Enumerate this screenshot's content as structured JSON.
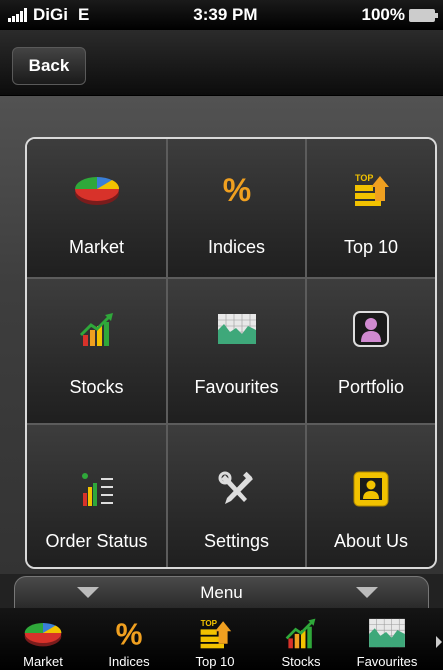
{
  "status_bar": {
    "carrier": "DiGi",
    "network": "E",
    "time": "3:39 PM",
    "battery": "100%"
  },
  "navbar": {
    "back_label": "Back"
  },
  "grid": {
    "items": [
      {
        "label": "Market",
        "icon": "pie-chart-icon"
      },
      {
        "label": "Indices",
        "icon": "percent-icon"
      },
      {
        "label": "Top 10",
        "icon": "top-icon"
      },
      {
        "label": "Stocks",
        "icon": "bar-trend-icon"
      },
      {
        "label": "Favourites",
        "icon": "area-chart-icon"
      },
      {
        "label": "Portfolio",
        "icon": "portfolio-icon"
      },
      {
        "label": "Order Status",
        "icon": "list-icon"
      },
      {
        "label": "Settings",
        "icon": "tools-icon"
      },
      {
        "label": "About Us",
        "icon": "person-icon"
      }
    ],
    "top_badge": "TOP"
  },
  "menu": {
    "label": "Menu"
  },
  "dock": {
    "items": [
      {
        "label": "Market",
        "icon": "pie-chart-icon"
      },
      {
        "label": "Indices",
        "icon": "percent-icon"
      },
      {
        "label": "Top 10",
        "icon": "top-icon"
      },
      {
        "label": "Stocks",
        "icon": "bar-trend-icon"
      },
      {
        "label": "Favourites",
        "icon": "area-chart-icon"
      }
    ]
  },
  "colors": {
    "accent_orange": "#f0a020",
    "green": "#2fa83a",
    "red": "#d8322a",
    "blue": "#3a7fd8",
    "yellow": "#f2c200"
  }
}
